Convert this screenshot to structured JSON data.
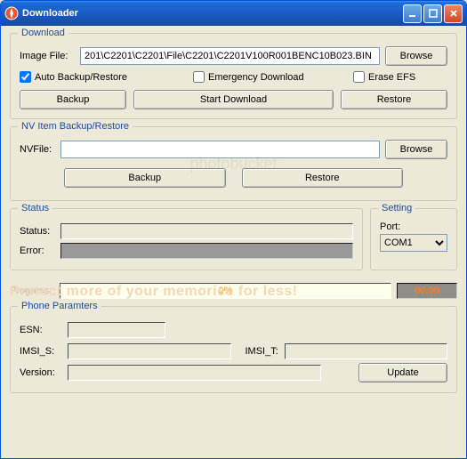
{
  "window": {
    "title": "Downloader"
  },
  "download": {
    "legend": "Download",
    "image_file_label": "Image File:",
    "image_file_value": "201\\C2201\\C2201\\File\\C2201\\C2201V100R001BENC10B023.BIN",
    "browse_label": "Browse",
    "auto_backup_label": "Auto Backup/Restore",
    "emergency_label": "Emergency Download",
    "erase_efs_label": "Erase EFS",
    "backup_btn": "Backup",
    "start_btn": "Start Download",
    "restore_btn": "Restore"
  },
  "nv": {
    "legend": "NV Item Backup/Restore",
    "nvfile_label": "NVFile:",
    "browse_label": "Browse",
    "backup_btn": "Backup",
    "restore_btn": "Restore"
  },
  "status": {
    "legend": "Status",
    "status_label": "Status:",
    "error_label": "Error:",
    "progress_label": "Progress:",
    "progress_value": "0%",
    "time_value": "00:00"
  },
  "setting": {
    "legend": "Setting",
    "port_label": "Port:",
    "port_value": "COM1"
  },
  "phone": {
    "legend": "Phone Paramters",
    "esn_label": "ESN:",
    "imsi_s_label": "IMSI_S:",
    "imsi_t_label": "IMSI_T:",
    "version_label": "Version:",
    "update_btn": "Update"
  },
  "watermark_text": "photobucket",
  "banner_text": "Protect more of your memories for less!"
}
